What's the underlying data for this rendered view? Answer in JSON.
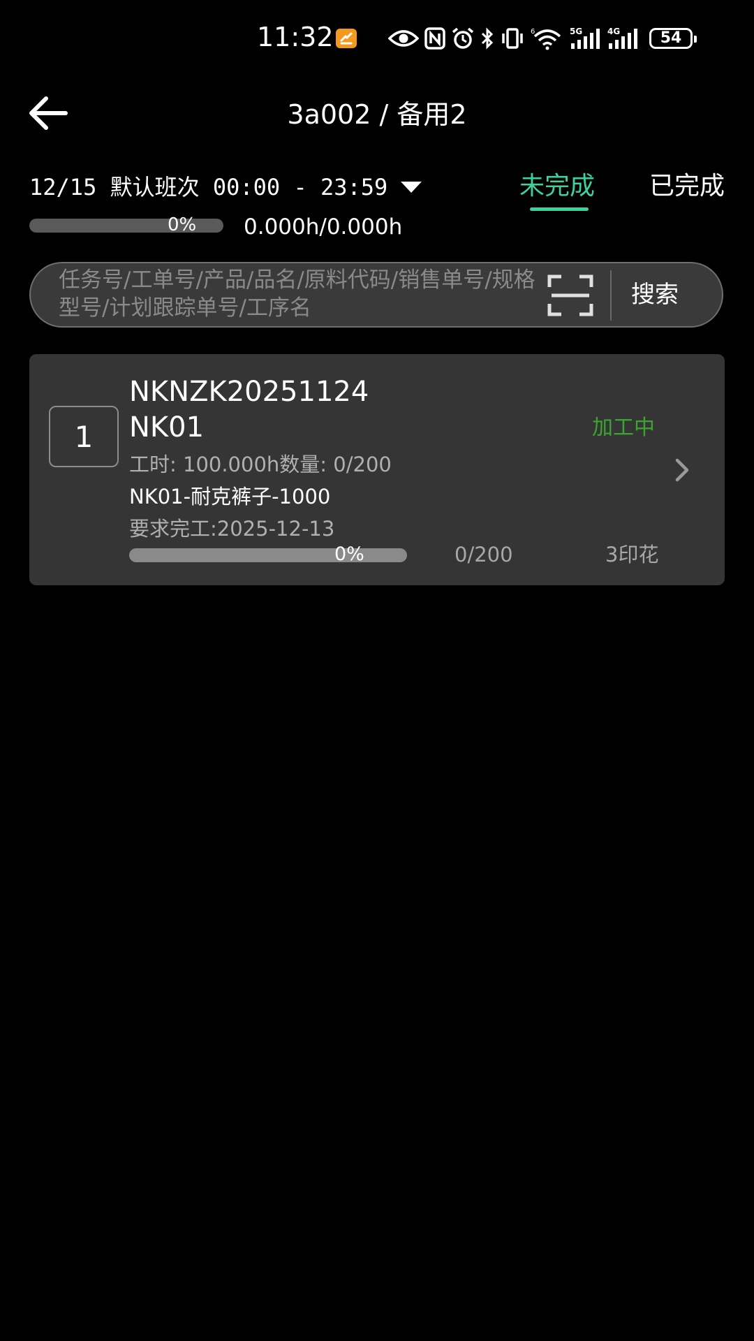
{
  "status_bar": {
    "time": "11:32",
    "battery": "54",
    "network_labels": [
      "6",
      "5G",
      "4G"
    ]
  },
  "header": {
    "title": "3a002 / 备用2"
  },
  "shift": {
    "selector_text": "12/15 默认班次 00:00 - 23:59"
  },
  "tabs": [
    {
      "label": "未完成",
      "active": true
    },
    {
      "label": "已完成",
      "active": false
    }
  ],
  "summary": {
    "progress_percent": 0,
    "progress_label": "0%",
    "hours": "0.000h/0.000h"
  },
  "search": {
    "placeholder": "任务号/工单号/产品/品名/原料代码/销售单号/规格型号/计划跟踪单号/工序名",
    "value": "",
    "button_label": "搜索"
  },
  "tasks": [
    {
      "index": "1",
      "task_no": "NKNZK20251124",
      "code": "NK01",
      "status": "加工中",
      "meta": "工时: 100.000h数量: 0/200",
      "product": "NK01-耐克裤子-1000",
      "due": "要求完工:2025-12-13",
      "progress_percent": 0,
      "progress_label": "0%",
      "quantity": "0/200",
      "process": "3印花"
    }
  ],
  "colors": {
    "background": "#000000",
    "accent": "#3fd0a0",
    "status_processing": "#3ba52f",
    "card": "#353535"
  }
}
